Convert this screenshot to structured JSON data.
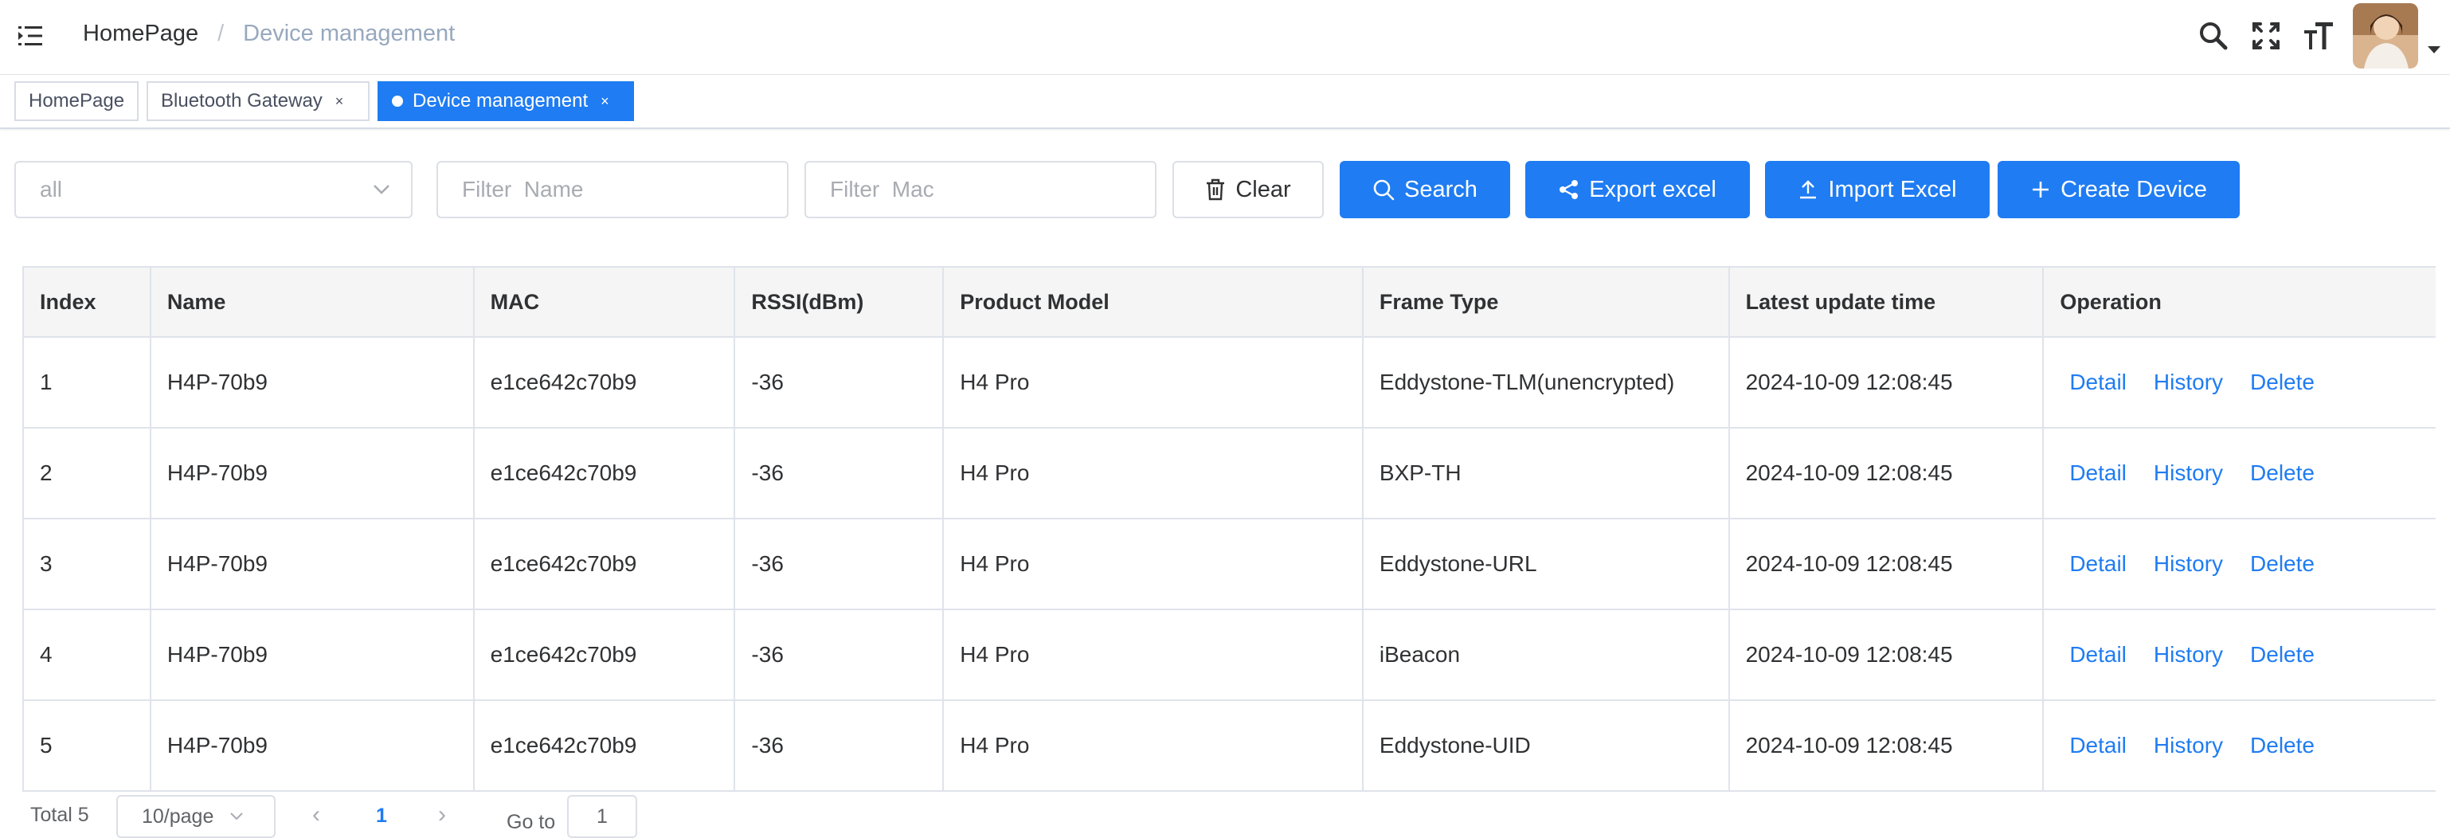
{
  "header": {
    "breadcrumb": {
      "home": "HomePage",
      "separator": "/",
      "current": "Device management"
    }
  },
  "tags": [
    {
      "label": "HomePage",
      "closable": false,
      "active": false
    },
    {
      "label": "Bluetooth Gateway",
      "closable": true,
      "active": false
    },
    {
      "label": "Device management",
      "closable": true,
      "active": true
    }
  ],
  "tag_close": "×",
  "filters": {
    "type_select": {
      "value": "all"
    },
    "name": {
      "placeholder": "Filter  Name"
    },
    "mac": {
      "placeholder": "Filter  Mac"
    }
  },
  "buttons": {
    "clear": "Clear",
    "search": "Search",
    "export": "Export excel",
    "import": "Import Excel",
    "create": "Create Device"
  },
  "table": {
    "columns": [
      "Index",
      "Name",
      "MAC",
      "RSSI(dBm)",
      "Product Model",
      "Frame Type",
      "Latest update time",
      "Operation"
    ],
    "rows": [
      [
        "1",
        "H4P-70b9",
        "e1ce642c70b9",
        "-36",
        "H4 Pro",
        "Eddystone-TLM(unencrypted)",
        "2024-10-09 12:08:45"
      ],
      [
        "2",
        "H4P-70b9",
        "e1ce642c70b9",
        "-36",
        "H4 Pro",
        "BXP-TH",
        "2024-10-09 12:08:45"
      ],
      [
        "3",
        "H4P-70b9",
        "e1ce642c70b9",
        "-36",
        "H4 Pro",
        "Eddystone-URL",
        "2024-10-09 12:08:45"
      ],
      [
        "4",
        "H4P-70b9",
        "e1ce642c70b9",
        "-36",
        "H4 Pro",
        "iBeacon",
        "2024-10-09 12:08:45"
      ],
      [
        "5",
        "H4P-70b9",
        "e1ce642c70b9",
        "-36",
        "H4 Pro",
        "Eddystone-UID",
        "2024-10-09 12:08:45"
      ]
    ],
    "operations": [
      "Detail",
      "History",
      "Delete"
    ]
  },
  "pagination": {
    "total": "Total 5",
    "page_size": "10/page",
    "current_page": "1",
    "goto_label": "Go to",
    "goto_value": "1"
  },
  "colors": {
    "primary": "#1f7cf2",
    "border": "#dcdfe6",
    "header_bg": "#f5f5f5"
  },
  "icons": [
    "hamburger-icon",
    "search-icon",
    "fullscreen-icon",
    "font-size-icon",
    "trash-icon",
    "share-icon",
    "upload-icon",
    "plus-icon"
  ]
}
